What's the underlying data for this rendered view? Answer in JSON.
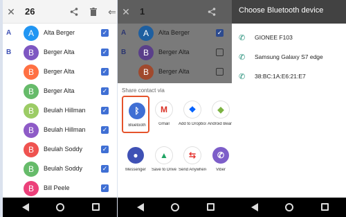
{
  "screen1": {
    "selected_count": "26",
    "contacts": [
      {
        "letter": "A",
        "initial": "A",
        "name": "Alta Berger",
        "color": "#2196f3"
      },
      {
        "letter": "B",
        "initial": "B",
        "name": "Berger Alta",
        "color": "#7e57c2"
      },
      {
        "letter": "",
        "initial": "B",
        "name": "Berger Alta",
        "color": "#ff7043"
      },
      {
        "letter": "",
        "initial": "B",
        "name": "Berger Alta",
        "color": "#66bb6a"
      },
      {
        "letter": "",
        "initial": "B",
        "name": "Beulah Hillman",
        "color": "#9ccc65"
      },
      {
        "letter": "",
        "initial": "B",
        "name": "Beulah Hillman",
        "color": "#8e5bc7"
      },
      {
        "letter": "",
        "initial": "B",
        "name": "Beulah Soddy",
        "color": "#ef5350"
      },
      {
        "letter": "",
        "initial": "B",
        "name": "Beulah Soddy",
        "color": "#66bb6a"
      },
      {
        "letter": "",
        "initial": "B",
        "name": "Bill Peele",
        "color": "#ec407a"
      }
    ]
  },
  "screen2": {
    "selected_count": "1",
    "contacts": [
      {
        "letter": "A",
        "initial": "A",
        "name": "Alta Berger",
        "color": "#1e5fa0",
        "checked": true
      },
      {
        "letter": "B",
        "initial": "B",
        "name": "Berger Alta",
        "color": "#5a3f8a",
        "checked": false
      },
      {
        "letter": "",
        "initial": "B",
        "name": "Berger Alta",
        "color": "#a0492d",
        "checked": false
      }
    ],
    "share_title": "Share contact via",
    "apps": [
      {
        "label": "Bluetooth",
        "glyph": "ᛒ",
        "color": "#3f6fd4"
      },
      {
        "label": "Gmail",
        "glyph": "M",
        "color": "#ffffff"
      },
      {
        "label": "Add to Dropbox",
        "glyph": "❖",
        "color": "#ffffff"
      },
      {
        "label": "Android Beam",
        "glyph": "◆",
        "color": "#ffffff"
      },
      {
        "label": "Messenger",
        "glyph": "●",
        "color": "#3f51b5"
      },
      {
        "label": "Save to Drive",
        "glyph": "▲",
        "color": "#ffffff"
      },
      {
        "label": "Send Anywhere",
        "glyph": "⇆",
        "color": "#ffffff"
      },
      {
        "label": "Viber",
        "glyph": "✆",
        "color": "#7d5ec9"
      }
    ]
  },
  "screen3": {
    "title": "Choose Bluetooth device",
    "devices": [
      "GIONEE F103",
      "Samsung Galaxy S7 edge",
      "38:BC:1A:E6:21:E7"
    ]
  }
}
